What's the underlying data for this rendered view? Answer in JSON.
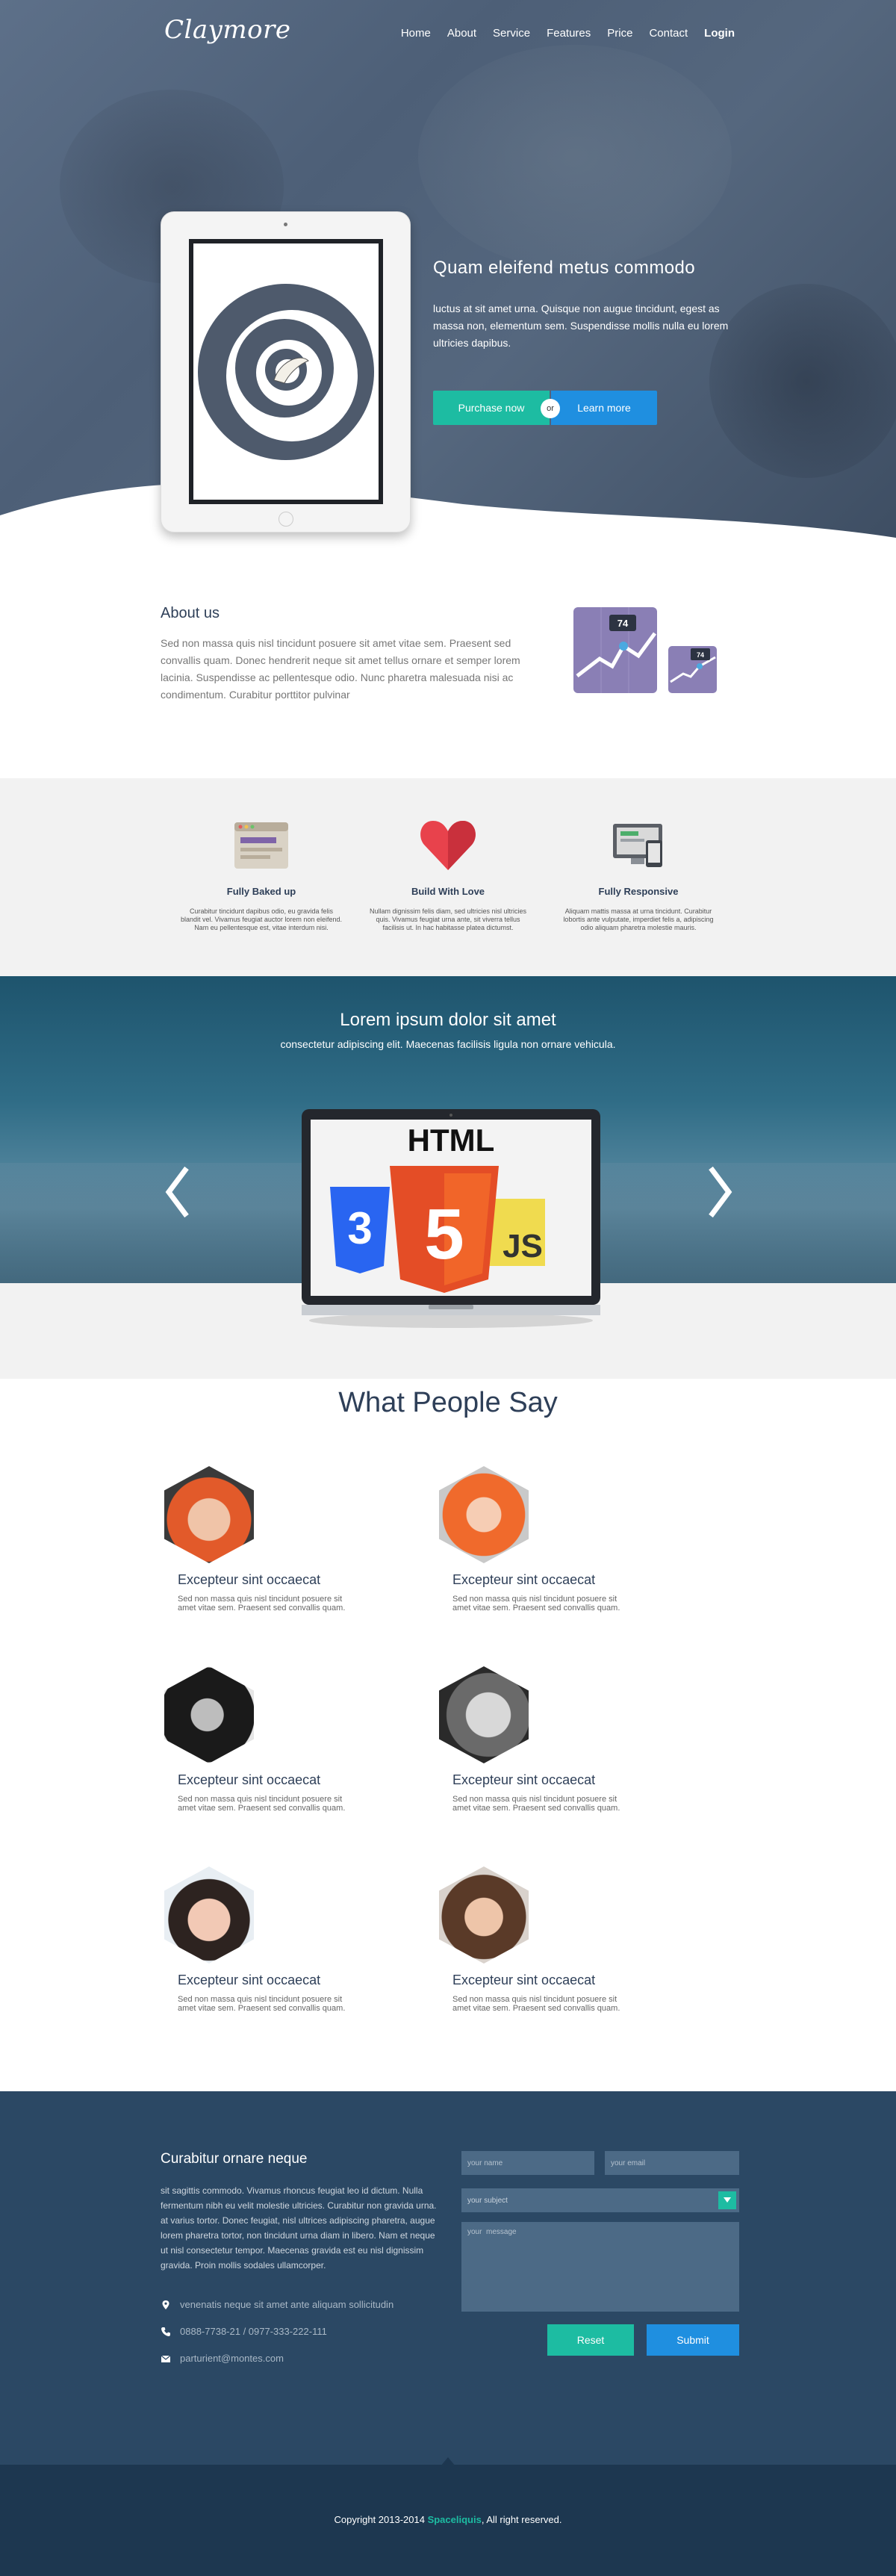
{
  "header": {
    "logo": "Claymore",
    "nav": [
      "Home",
      "About",
      "Service",
      "Features",
      "Price",
      "Contact",
      "Login"
    ]
  },
  "hero": {
    "title": "Quam eleifend metus commodo",
    "description": "luctus at sit amet urna. Quisque non augue tincidunt, egest as massa non, elementum sem. Suspendisse mollis nulla eu lorem ultricies dapibus.",
    "purchase_label": "Purchase now",
    "or_label": "or",
    "learn_label": "Learn more"
  },
  "about": {
    "title": "About us",
    "text": "Sed non massa quis nisl tincidunt posuere sit amet vitae sem. Praesent sed convallis quam. Donec hendrerit neque sit amet tellus ornare et semper lorem lacinia. Suspendisse ac pellentesque odio. Nunc pharetra malesuada nisi ac condimentum. Curabitur porttitor pulvinar",
    "badge_big": "74",
    "badge_small": "74"
  },
  "features": [
    {
      "icon": "browser-icon",
      "title": "Fully Baked up",
      "text": "Curabitur tincidunt dapibus odio, eu gravida felis blandit vel. Vivamus feugiat auctor lorem non eleifend. Nam eu pellentesque est, vitae interdum nisi."
    },
    {
      "icon": "heart-icon",
      "title": "Build With Love",
      "text": "Nullam dignissim felis diam, sed ultricies nisl ultricies quis. Vivamus feugiat urna ante, sit viverra tellus facilisis ut. In hac habitasse platea dictumst."
    },
    {
      "icon": "devices-icon",
      "title": "Fully Responsive",
      "text": "Aliquam mattis massa at urna tincidunt. Curabitur lobortis ante vulputate, imperdiet felis a, adipiscing odio aliquam pharetra molestie mauris."
    }
  ],
  "slider": {
    "title": "Lorem ipsum dolor sit amet",
    "subtitle": "consectetur adipiscing elit. Maecenas facilisis ligula non ornare vehicula.",
    "screen_heading": "HTML",
    "badge_css": "3",
    "badge_html": "5",
    "badge_js": "JS"
  },
  "testimonials": {
    "title": "What People Say",
    "items": [
      {
        "name": "Excepteur sint occaecat",
        "text": "Sed non massa quis nisl tincidunt posuere sit amet vitae sem. Praesent sed convallis quam."
      },
      {
        "name": "Excepteur sint occaecat",
        "text": "Sed non massa quis nisl tincidunt posuere sit amet vitae sem. Praesent sed convallis quam."
      },
      {
        "name": "Excepteur sint occaecat",
        "text": "Sed non massa quis nisl tincidunt posuere sit amet vitae sem. Praesent sed convallis quam."
      },
      {
        "name": "Excepteur sint occaecat",
        "text": "Sed non massa quis nisl tincidunt posuere sit amet vitae sem. Praesent sed convallis quam."
      },
      {
        "name": "Excepteur sint occaecat",
        "text": "Sed non massa quis nisl tincidunt posuere sit amet vitae sem. Praesent sed convallis quam."
      },
      {
        "name": "Excepteur sint occaecat",
        "text": "Sed non massa quis nisl tincidunt posuere sit amet vitae sem. Praesent sed convallis quam."
      }
    ]
  },
  "contact": {
    "title": "Curabitur ornare neque",
    "text": "sit sagittis commodo. Vivamus rhoncus feugiat leo id dictum. Nulla fermentum nibh eu velit molestie ultricies. Curabitur non gravida urna. at varius tortor. Donec feugiat, nisl ultrices adipiscing pharetra, augue lorem pharetra tortor, non tincidunt urna diam in libero. Nam et neque ut nisl consectetur tempor. Maecenas gravida est eu nisl dignissim gravida. Proin mollis sodales ullamcorper.",
    "address": "venenatis neque sit amet ante aliquam sollicitudin",
    "phone": "0888-7738-21 / 0977-333-222-111",
    "email": "parturient@montes.com",
    "form": {
      "name_placeholder": "your name",
      "email_placeholder": "your email",
      "subject_placeholder": "your subject",
      "message_placeholder": "your  message",
      "reset_label": "Reset",
      "submit_label": "Submit"
    }
  },
  "footer": {
    "copyright_prefix": "Copyright 2013-2014 ",
    "brand": "Spaceliquis",
    "copyright_suffix": ", All right reserved."
  },
  "colors": {
    "accent_teal": "#1dbca2",
    "accent_blue": "#1f8fe0",
    "navy": "#2e3f58",
    "contact_bg": "#2b4864",
    "footer_bg": "#1d3750"
  }
}
